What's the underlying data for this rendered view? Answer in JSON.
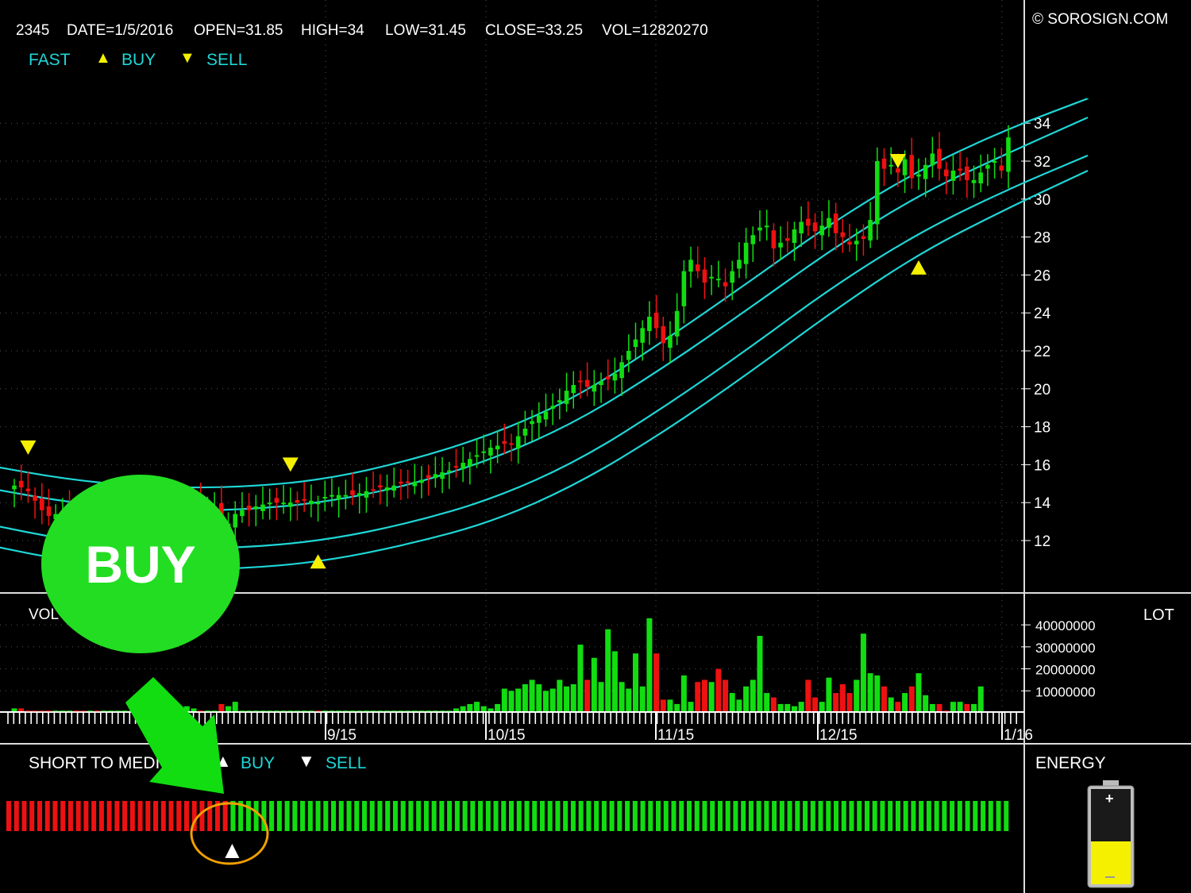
{
  "header": {
    "symbol": "2345",
    "date": "DATE=1/5/2016",
    "open": "OPEN=31.85",
    "high": "HIGH=34",
    "low": "LOW=31.45",
    "close": "CLOSE=33.25",
    "vol": "VOL=12820270",
    "copyright": "© SOROSIGN.COM"
  },
  "legend": {
    "fast": "FAST",
    "buy": "BUY",
    "sell": "SELL"
  },
  "volume_panel": {
    "label": "VOL",
    "unit": "LOT"
  },
  "indicator_panel": {
    "label": "SHORT TO MEDIUM",
    "buy": "BUY",
    "sell": "SELL",
    "energy_label": "ENERGY"
  },
  "badge": {
    "text": "BUY"
  },
  "colors": {
    "up": "#11dd11",
    "down": "#ee1111",
    "band": "#1fd6d6",
    "marker": "#f5f000",
    "grid": "#555555",
    "badge": "#22dd22",
    "highlight": "#f0a000"
  },
  "chart_data": {
    "type": "candlestick",
    "price_axis": {
      "ticks": [
        12,
        14,
        16,
        18,
        20,
        22,
        24,
        26,
        28,
        30,
        32,
        34
      ],
      "range": [
        10,
        36
      ]
    },
    "date_ticks": [
      "9/15",
      "10/15",
      "11/15",
      "12/15",
      "1/16"
    ],
    "band_lines": [
      {
        "name": "upper2",
        "values": [
          16.0,
          15.2,
          14.8,
          14.8,
          15.2,
          16.2,
          17.6,
          19.6,
          22.5,
          25.6,
          28.8,
          31.5,
          33.6,
          35.3
        ]
      },
      {
        "name": "upper1",
        "values": [
          14.8,
          14.0,
          13.6,
          13.6,
          14.0,
          14.9,
          16.3,
          18.3,
          21.1,
          24.2,
          27.4,
          30.2,
          32.3,
          34.3
        ]
      },
      {
        "name": "lower1",
        "values": [
          12.9,
          12.0,
          11.6,
          11.6,
          12.0,
          12.9,
          14.2,
          16.2,
          19.0,
          22.1,
          25.4,
          28.2,
          30.4,
          32.3
        ]
      },
      {
        "name": "lower2",
        "values": [
          11.8,
          10.9,
          10.5,
          10.5,
          10.9,
          11.8,
          13.0,
          15.0,
          17.7,
          20.8,
          24.1,
          27.1,
          29.4,
          31.5
        ]
      }
    ],
    "closes": [
      14.9,
      14.8,
      14.6,
      14.1,
      13.6,
      13.3,
      13.4,
      13.5,
      13.5,
      13.4,
      13.3,
      13.4,
      13.2,
      13.2,
      13.2,
      13.3,
      13.3,
      13.3,
      13.4,
      13.5,
      13.5,
      13.6,
      13.8,
      13.8,
      13.8,
      13.9,
      13.9,
      13.8,
      13.8,
      13.8,
      12.6,
      12.9,
      13.4,
      13.6,
      13.6,
      13.8,
      13.9,
      14.0,
      14.0,
      14.0,
      14.0,
      14.0,
      14.1,
      14.1,
      14.0,
      14.3,
      14.4,
      14.4,
      14.4,
      14.4,
      14.5,
      14.6,
      14.7,
      14.8,
      14.8,
      14.9,
      15.0,
      15.1,
      15.1,
      15.2,
      15.3,
      15.5,
      15.6,
      15.7,
      15.9,
      16.1,
      16.3,
      16.5,
      16.7,
      16.9,
      17.0,
      17.1,
      17.1,
      17.5,
      17.9,
      18.3,
      18.6,
      18.8,
      19.1,
      19.4,
      19.9,
      20.2,
      20.4,
      20.1,
      20.2,
      20.4,
      20.5,
      20.8,
      21.4,
      22.0,
      22.6,
      23.2,
      23.8,
      23.2,
      22.4,
      22.8,
      24.1,
      26.2,
      26.8,
      26.2,
      25.6,
      25.9,
      25.8,
      25.4,
      26.2,
      26.8,
      27.7,
      28.1,
      28.5,
      28.6,
      27.4,
      27.7,
      27.8,
      28.4,
      28.8,
      28.6,
      28.3,
      28.6,
      29.0,
      28.2,
      28.0,
      27.6,
      27.8,
      27.9,
      28.9,
      32.0,
      31.6,
      31.8,
      31.4,
      32.1,
      31.1,
      31.3,
      31.8,
      32.4,
      31.6,
      31.2,
      31.5,
      31.5,
      31.0,
      31.0,
      31.4,
      31.8,
      32.0,
      31.5,
      33.25
    ],
    "volume_axis": {
      "ticks": [
        10000000,
        20000000,
        30000000,
        40000000
      ]
    },
    "volumes": [
      2,
      2,
      1,
      1,
      1,
      1,
      1,
      1,
      1,
      1,
      1,
      1,
      1,
      1,
      1,
      1,
      1,
      1,
      1,
      1,
      1,
      1,
      1,
      2,
      2,
      3,
      2,
      1,
      1,
      1,
      4,
      3,
      5,
      1,
      1,
      1,
      1,
      1,
      1,
      1,
      1,
      1,
      1,
      1,
      1,
      1,
      1,
      1,
      1,
      1,
      1,
      1,
      1,
      1,
      1,
      1,
      1,
      1,
      1,
      1,
      1,
      1,
      1,
      1,
      2,
      3,
      4,
      5,
      3,
      2,
      4,
      11,
      10,
      11,
      13,
      15,
      13,
      10,
      11,
      15,
      12,
      13,
      31,
      15,
      25,
      14,
      38,
      28,
      14,
      11,
      27,
      12,
      43,
      27,
      6,
      6,
      4,
      17,
      5,
      14,
      15,
      14,
      20,
      15,
      9,
      6,
      12,
      15,
      35,
      9,
      7,
      4,
      4,
      3,
      5,
      15,
      7,
      5,
      16,
      9,
      13,
      9,
      15,
      36,
      18,
      17,
      12,
      7,
      5,
      9,
      12,
      18,
      8,
      4,
      4,
      1,
      5,
      5,
      4,
      4,
      12
    ],
    "signal_panel": {
      "red_bars": 29,
      "green_bars": 101,
      "buy_marker_index": 29
    },
    "energy_level": 0.45
  }
}
